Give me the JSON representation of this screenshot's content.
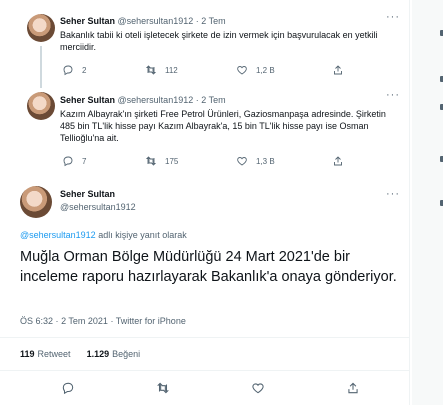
{
  "tweets": [
    {
      "name": "Seher Sultan",
      "handle": "@sehersultan1912",
      "time": "2 Tem",
      "text": "Bakanlık tabii ki oteli işletecek şirkete de izin vermek için başvurulacak en yetkili merciidir.",
      "reply_count": "2",
      "retweet_count": "112",
      "like_count": "1,2 B"
    },
    {
      "name": "Seher Sultan",
      "handle": "@sehersultan1912",
      "time": "2 Tem",
      "text": "Kazım Albayrak'ın şirketi Free Petrol Ürünleri, Gaziosmanpaşa adresinde. Şirketin 485 bin TL'lik hisse payı Kazım Albayrak'a, 15 bin TL'lik hisse payı ise Osman Tellioğlu'na ait.",
      "reply_count": "7",
      "retweet_count": "175",
      "like_count": "1,3 B"
    }
  ],
  "focused": {
    "name": "Seher Sultan",
    "handle": "@sehersultan1912",
    "reply_link": "@sehersultan1912",
    "reply_suffix": " adlı kişiye yanıt olarak",
    "text": "Muğla Orman Bölge Müdürlüğü 24 Mart 2021'de bir inceleme raporu hazırlayarak Bakanlık'a onaya gönderiyor.",
    "time": "ÖS 6:32",
    "date": "2 Tem 2021",
    "source": "Twitter for iPhone",
    "retweets_value": "119",
    "retweets_label": "Retweet",
    "likes_value": "1.129",
    "likes_label": "Beğeni"
  },
  "separator_dot": "·",
  "more_icon": "more-icon",
  "colors": {
    "accent": "#1d9bf0",
    "muted": "#536471",
    "text": "#0f1419",
    "border": "#eff3f4"
  }
}
